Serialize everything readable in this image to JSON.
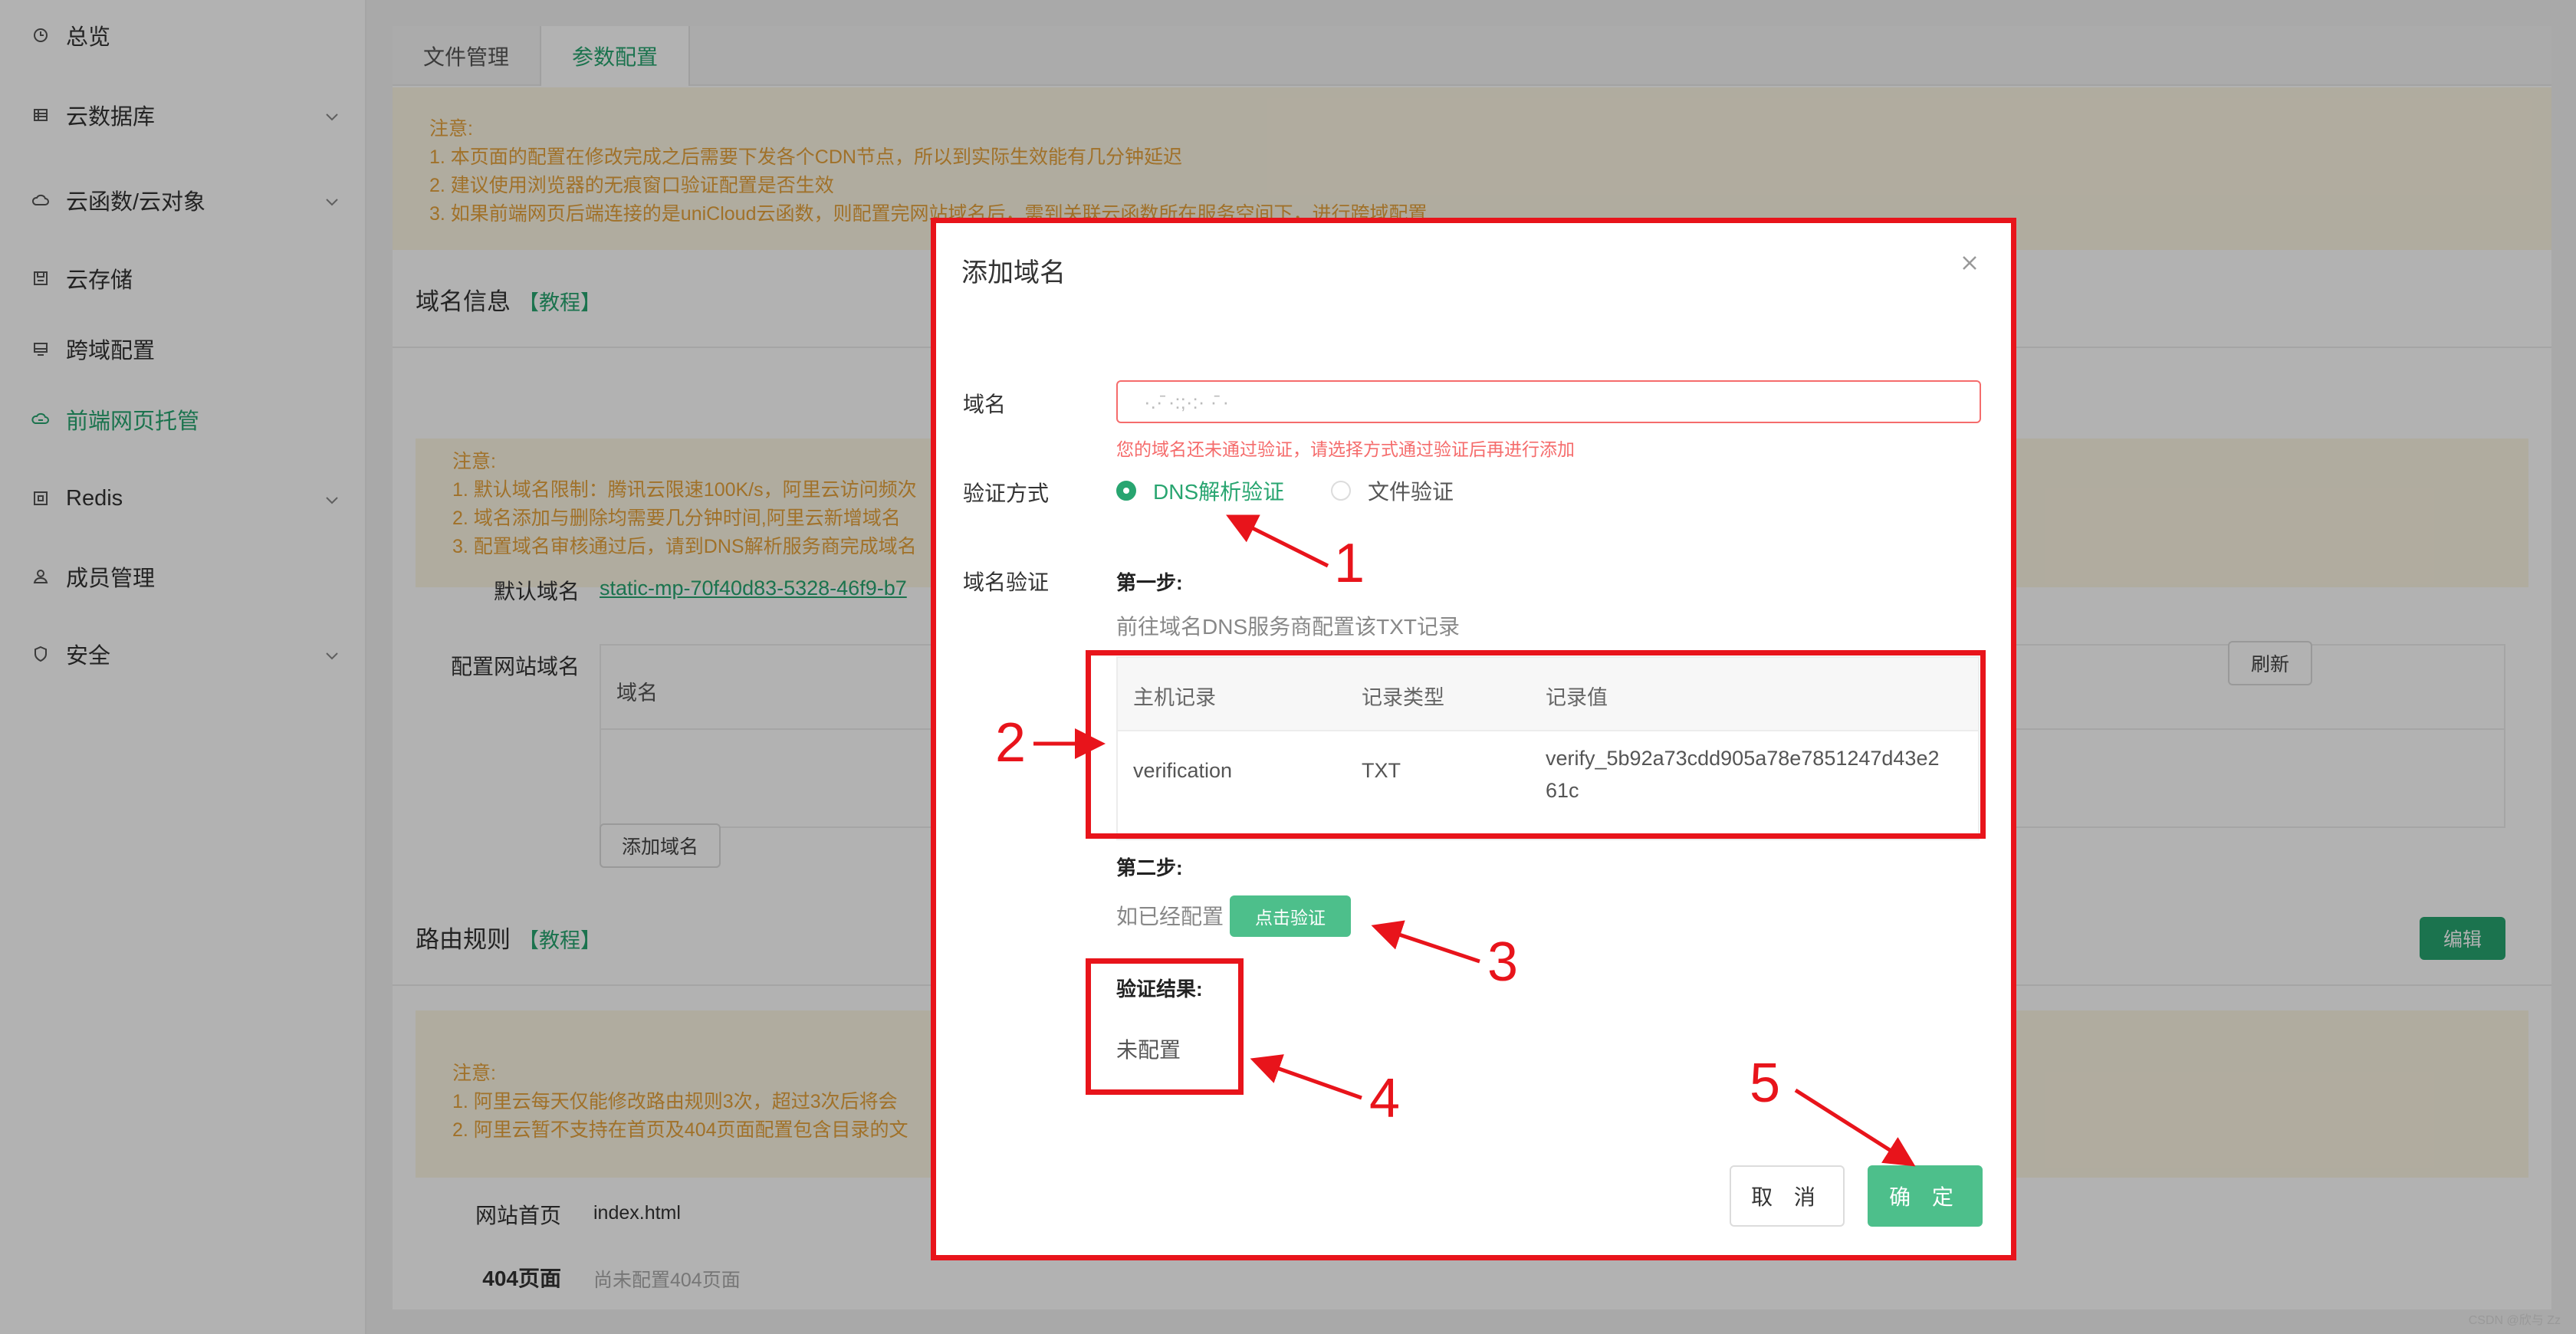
{
  "sidebar": {
    "items": [
      {
        "label": "总览",
        "icon": "clock-icon",
        "has_chevron": false
      },
      {
        "label": "云数据库",
        "icon": "database-icon",
        "has_chevron": true
      },
      {
        "label": "云函数/云对象",
        "icon": "cloud-icon",
        "has_chevron": true
      },
      {
        "label": "云存储",
        "icon": "storage-icon",
        "has_chevron": false
      },
      {
        "label": "跨域配置",
        "icon": "monitor-icon",
        "has_chevron": false
      },
      {
        "label": "前端网页托管",
        "icon": "hosting-icon",
        "has_chevron": false,
        "active": true
      },
      {
        "label": "Redis",
        "icon": "redis-icon",
        "has_chevron": true
      },
      {
        "label": "成员管理",
        "icon": "user-icon",
        "has_chevron": false
      },
      {
        "label": "安全",
        "icon": "shield-icon",
        "has_chevron": true
      }
    ]
  },
  "main": {
    "tabs": [
      {
        "label": "文件管理",
        "active": false
      },
      {
        "label": "参数配置",
        "active": true
      }
    ],
    "notice_top": {
      "title": "注意:",
      "lines": [
        "1. 本页面的配置在修改完成之后需要下发各个CDN节点，所以到实际生效能有几分钟延迟",
        "2. 建议使用浏览器的无痕窗口验证配置是否生效",
        "3. 如果前端网页后端连接的是uniCloud云函数，则配置完网站域名后，需到关联云函数所在服务空间下，进行跨域配置"
      ]
    },
    "domain_section": {
      "title": "域名信息",
      "tutorial_link": "【教程】",
      "notice": {
        "title": "注意:",
        "lines": [
          "1. 默认域名限制：腾讯云限速100K/s，阿里云访问频次",
          "2. 域名添加与删除均需要几分钟时间,阿里云新增域名",
          "3. 配置域名审核通过后，请到DNS解析服务商完成域名"
        ]
      },
      "default_domain_label": "默认域名",
      "default_domain_value": "static-mp-70f40d83-5328-46f9-b7",
      "site_domain_label": "配置网站域名",
      "table_header_domain": "域名",
      "refresh_button": "刷新",
      "add_domain_button": "添加域名"
    },
    "route_section": {
      "title": "路由规则",
      "tutorial_link": "【教程】",
      "edit_button": "编辑",
      "notice": {
        "title": "注意:",
        "lines": [
          "1. 阿里云每天仅能修改路由规则3次，超过3次后将会",
          "2. 阿里云暂不支持在首页及404页面配置包含目录的文"
        ]
      },
      "index_label": "网站首页",
      "index_value": "index.html",
      "page404_label": "404页面",
      "page404_value": "尚未配置404页面"
    }
  },
  "dialog": {
    "title": "添加域名",
    "domain_label": "域名",
    "domain_value": "·.·̄ ·:;·:· ·̄ ·",
    "domain_error": "您的域名还未通过验证，请选择方式通过验证后再进行添加",
    "verify_method_label": "验证方式",
    "verify_options": [
      {
        "label": "DNS解析验证",
        "checked": true
      },
      {
        "label": "文件验证",
        "checked": false
      }
    ],
    "domain_verify_label": "域名验证",
    "step1_title": "第一步:",
    "step1_desc": "前往域名DNS服务商配置该TXT记录",
    "record_table": {
      "headers": [
        "主机记录",
        "记录类型",
        "记录值"
      ],
      "row": [
        "verification",
        "TXT",
        "verify_5b92a73cdd905a78e7851247d43e2",
        "61c"
      ]
    },
    "step2_title": "第二步:",
    "step2_desc": "如已经配置",
    "verify_button": "点击验证",
    "result_title": "验证结果:",
    "result_value": "未配置",
    "cancel_button": "取 消",
    "ok_button": "确 定"
  },
  "annotations": [
    "1",
    "2",
    "3",
    "4",
    "5"
  ],
  "watermark": "CSDN @欣与 Zz",
  "colors": {
    "brand_green": "#28a570",
    "confirm_green": "#4dbf8b",
    "error_red": "#f56c6c",
    "annotation_red": "#e8141b",
    "notice_bg": "#fdf6e4",
    "notice_text": "#e6a23c"
  }
}
